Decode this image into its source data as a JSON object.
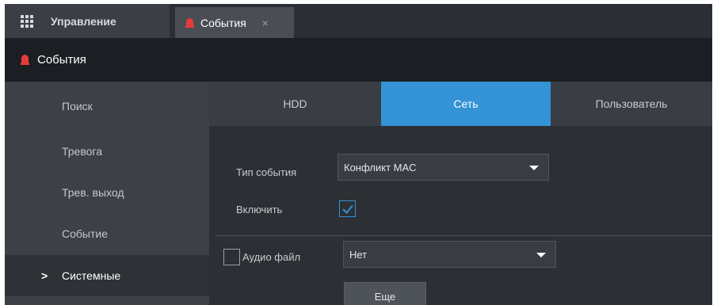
{
  "topbar": {
    "management_label": "Управление",
    "events_tab_label": "События",
    "close_glyph": "×"
  },
  "title": "События",
  "sidebar": {
    "items": [
      {
        "label": "Поиск",
        "active": false
      },
      {
        "label": "Тревога",
        "active": false
      },
      {
        "label": "Трев. выход",
        "active": false
      },
      {
        "label": "Событие",
        "active": false
      },
      {
        "label": "Системные",
        "active": true
      }
    ],
    "active_marker": ">"
  },
  "tabs": [
    {
      "label": "HDD",
      "active": false
    },
    {
      "label": "Сеть",
      "active": true
    },
    {
      "label": "Пользователь",
      "active": false
    }
  ],
  "form": {
    "event_type_label": "Тип события",
    "event_type_value": "Конфликт MAC",
    "enable_label": "Включить",
    "enable_checked": true,
    "audio_label": "Аудио файл",
    "audio_checked": false,
    "audio_value": "Нет",
    "more_button": "Еще"
  },
  "colors": {
    "accent": "#3393d6",
    "alarm": "#e63b3b"
  }
}
